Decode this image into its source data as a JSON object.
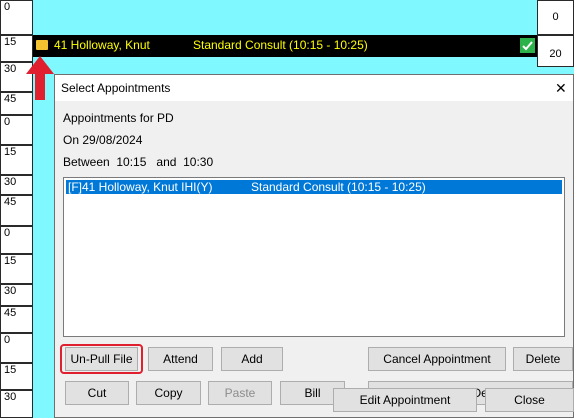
{
  "time_grid": {
    "left_slots": [
      "0",
      "15",
      "30",
      "45",
      "0",
      "15",
      "30",
      "45",
      "0",
      "15",
      "30",
      "45",
      "0",
      "15",
      "30"
    ],
    "right_slots": [
      "0",
      "20"
    ]
  },
  "booking_bar": {
    "patient": "41 Holloway, Knut",
    "appointment": "Standard Consult (10:15 - 10:25)"
  },
  "dialog": {
    "title": "Select Appointments",
    "close_glyph": "✕",
    "appointments_for": "Appointments for PD",
    "on_date": "On 29/08/2024",
    "between_label": "Between",
    "between_start": "10:15",
    "and_label": "and",
    "between_end": "10:30",
    "list_items": [
      {
        "patient": "[F]41 Holloway, Knut IHI(Y)",
        "appointment": "Standard Consult (10:15 - 10:25)"
      }
    ],
    "buttons": {
      "unpull": "Un-Pull File",
      "attend": "Attend",
      "add": "Add",
      "cancel_appointment": "Cancel Appointment",
      "delete": "Delete",
      "cut": "Cut",
      "copy": "Copy",
      "paste": "Paste",
      "bill": "Bill",
      "patient_details": "Patient Details",
      "edit_appointment": "Edit Appointment",
      "close": "Close"
    }
  },
  "colors": {
    "grid_bg": "#7ff8ff",
    "booking_bar": "#000000",
    "booking_text": "#ffff00",
    "selection": "#0078d7",
    "highlight_red": "#e0202e"
  }
}
